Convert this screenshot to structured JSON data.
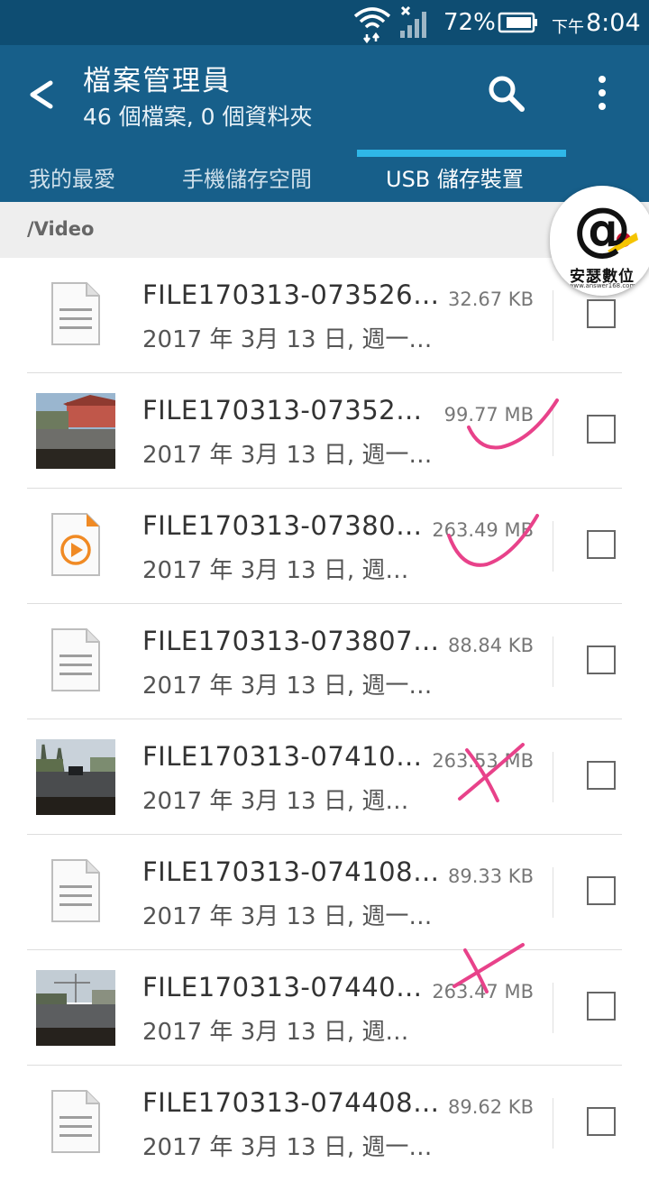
{
  "status_bar": {
    "battery_percent": "72%",
    "time_prefix": "下午",
    "time": "8:04"
  },
  "app_bar": {
    "title": "檔案管理員",
    "subtitle": "46 個檔案, 0 個資料夾"
  },
  "tabs": [
    {
      "label": "我的最愛",
      "active": false
    },
    {
      "label": "手機儲存空間",
      "active": false
    },
    {
      "label": "USB 儲存裝置",
      "active": true
    }
  ],
  "path": "/Video",
  "watermark": {
    "brand": "安瑟數位",
    "url": "www.answer168.com"
  },
  "files": [
    {
      "name": "FILE170313-073526…",
      "date": "2017 年 3月 13 日, 週一…",
      "size": "32.67 KB",
      "icon": "document-icon",
      "checked": false
    },
    {
      "name": "FILE170313-07352…",
      "date": "2017 年 3月 13 日, 週一…",
      "size": "99.77 MB",
      "icon": "video-thumbnail",
      "checked": false
    },
    {
      "name": "FILE170313-07380…",
      "date": "2017 年 3月 13 日, 週…",
      "size": "263.49 MB",
      "icon": "video-file-icon",
      "checked": false
    },
    {
      "name": "FILE170313-073807…",
      "date": "2017 年 3月 13 日, 週一…",
      "size": "88.84 KB",
      "icon": "document-icon",
      "checked": false
    },
    {
      "name": "FILE170313-07410…",
      "date": "2017 年 3月 13 日, 週…",
      "size": "263.53 MB",
      "icon": "video-thumbnail",
      "checked": false
    },
    {
      "name": "FILE170313-074108…",
      "date": "2017 年 3月 13 日, 週一…",
      "size": "89.33 KB",
      "icon": "document-icon",
      "checked": false
    },
    {
      "name": "FILE170313-07440…",
      "date": "2017 年 3月 13 日, 週…",
      "size": "263.47 MB",
      "icon": "video-thumbnail",
      "checked": false
    },
    {
      "name": "FILE170313-074408…",
      "date": "2017 年 3月 13 日, 週一…",
      "size": "89.62 KB",
      "icon": "document-icon",
      "checked": false
    }
  ],
  "colors": {
    "status_bar": "#0e4d72",
    "app_bar": "#175f8a",
    "tab_indicator": "#2fb7e8",
    "annotation_marks": "#e8428a"
  }
}
